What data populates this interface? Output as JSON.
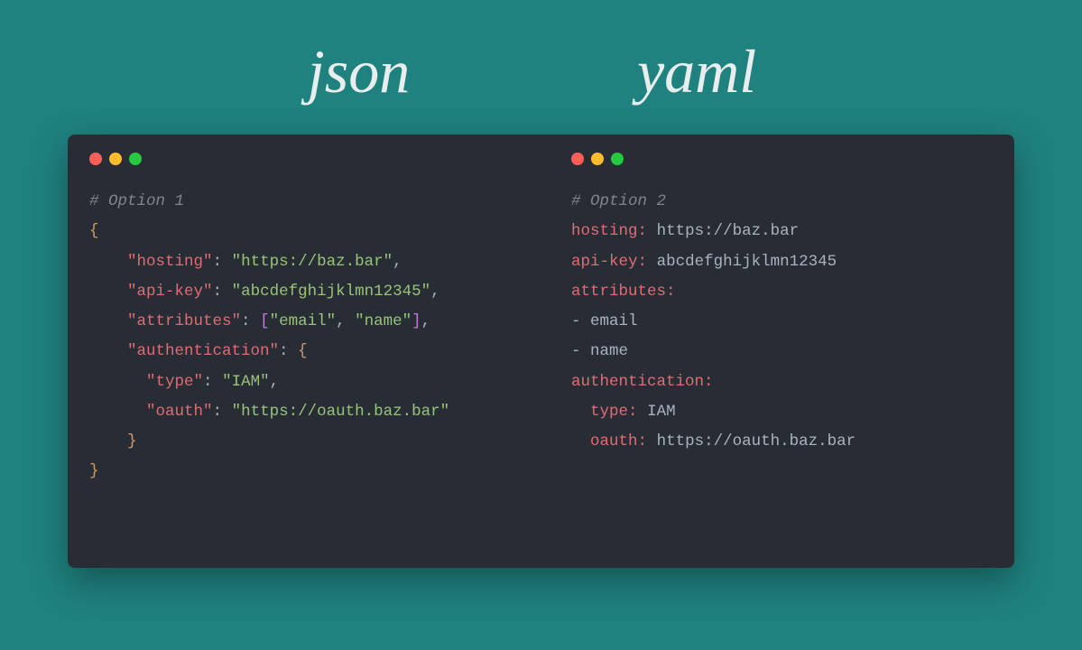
{
  "headings": {
    "left": "json",
    "right": "yaml"
  },
  "json_panel": {
    "comment": "# Option 1",
    "open_brace": "{",
    "key_hosting": "\"hosting\"",
    "val_hosting": "\"https://baz.bar\"",
    "key_apikey": "\"api-key\"",
    "val_apikey": "\"abcdefghijklmn12345\"",
    "key_attributes": "\"attributes\"",
    "attr_open": "[",
    "attr_email": "\"email\"",
    "attr_name": "\"name\"",
    "attr_close": "]",
    "key_auth": "\"authentication\"",
    "auth_open": "{",
    "key_type": "\"type\"",
    "val_type": "\"IAM\"",
    "key_oauth": "\"oauth\"",
    "val_oauth": "\"https://oauth.baz.bar\"",
    "auth_close": "}",
    "close_brace": "}",
    "colon": ":",
    "comma": ",",
    "indent1": "    ",
    "indent2": "      "
  },
  "yaml_panel": {
    "comment": "# Option 2",
    "key_hosting": "hosting:",
    "val_hosting": "https://baz.bar",
    "key_apikey": "api-key:",
    "val_apikey": "abcdefghijklmn12345",
    "key_attributes": "attributes:",
    "dash": "- ",
    "attr_email": "email",
    "attr_name": "name",
    "key_auth": "authentication:",
    "key_type": "type:",
    "val_type": "IAM",
    "key_oauth": "oauth:",
    "val_oauth": "https://oauth.baz.bar",
    "indent": "  "
  }
}
